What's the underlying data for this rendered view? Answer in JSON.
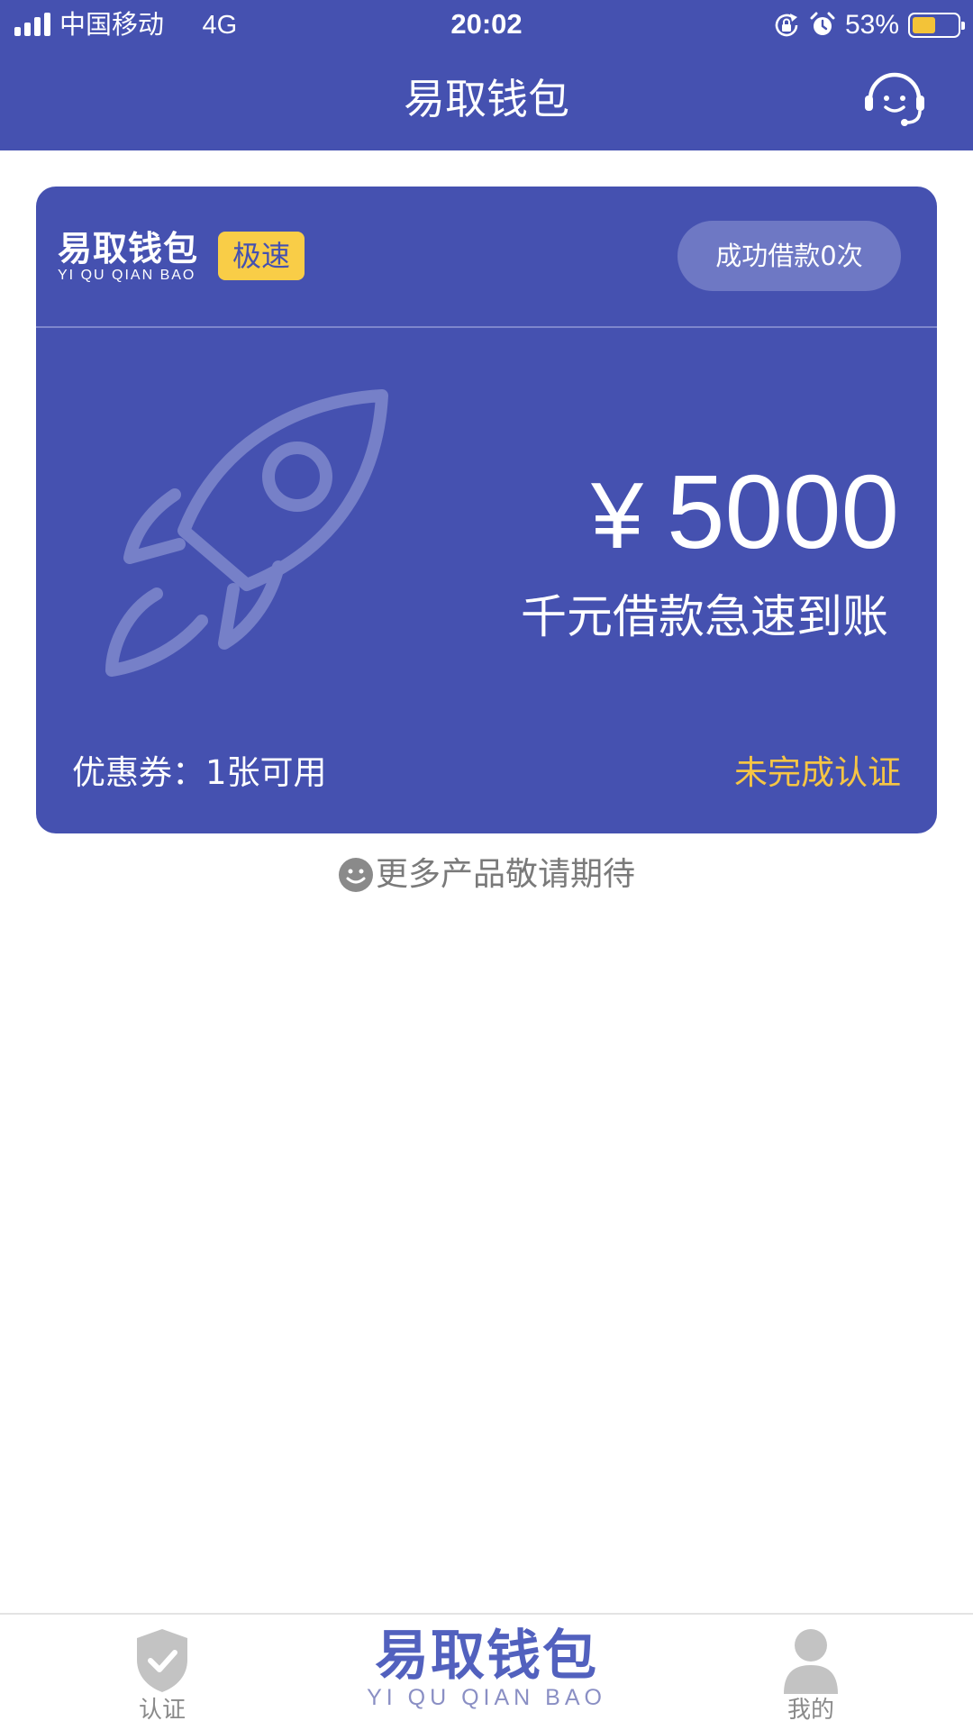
{
  "status_bar": {
    "carrier": "中国移动",
    "network": "4G",
    "time": "20:02",
    "battery_percent_label": "53%",
    "battery_level": 0.53,
    "battery_color": "#f3c338",
    "icons": [
      "signal-icon",
      "rotation-lock-icon",
      "alarm-icon",
      "battery-icon"
    ]
  },
  "header": {
    "title": "易取钱包",
    "right_icon": "customer-service-headset-icon",
    "background": "#4551b0"
  },
  "card": {
    "brand_cn": "易取钱包",
    "brand_en": "YI QU QIAN BAO",
    "badge": "极速",
    "badge_color": "#f9cd47",
    "success_count": "成功借款0次",
    "illustration": "rocket-icon",
    "amount_currency": "¥",
    "amount_value": "5000",
    "tagline": "千元借款急速到账",
    "coupon": "优惠券：1张可用",
    "verify_status": "未完成认证",
    "verify_status_color": "#f6c544"
  },
  "more_products": {
    "icon": "smiley-icon",
    "text": "更多产品敬请期待"
  },
  "tab_bar": {
    "verify": {
      "icon": "shield-check-icon",
      "label": "认证"
    },
    "brand": {
      "cn": "易取钱包",
      "en": "YI QU QIAN BAO"
    },
    "mine": {
      "icon": "user-icon",
      "label": "我的"
    }
  }
}
